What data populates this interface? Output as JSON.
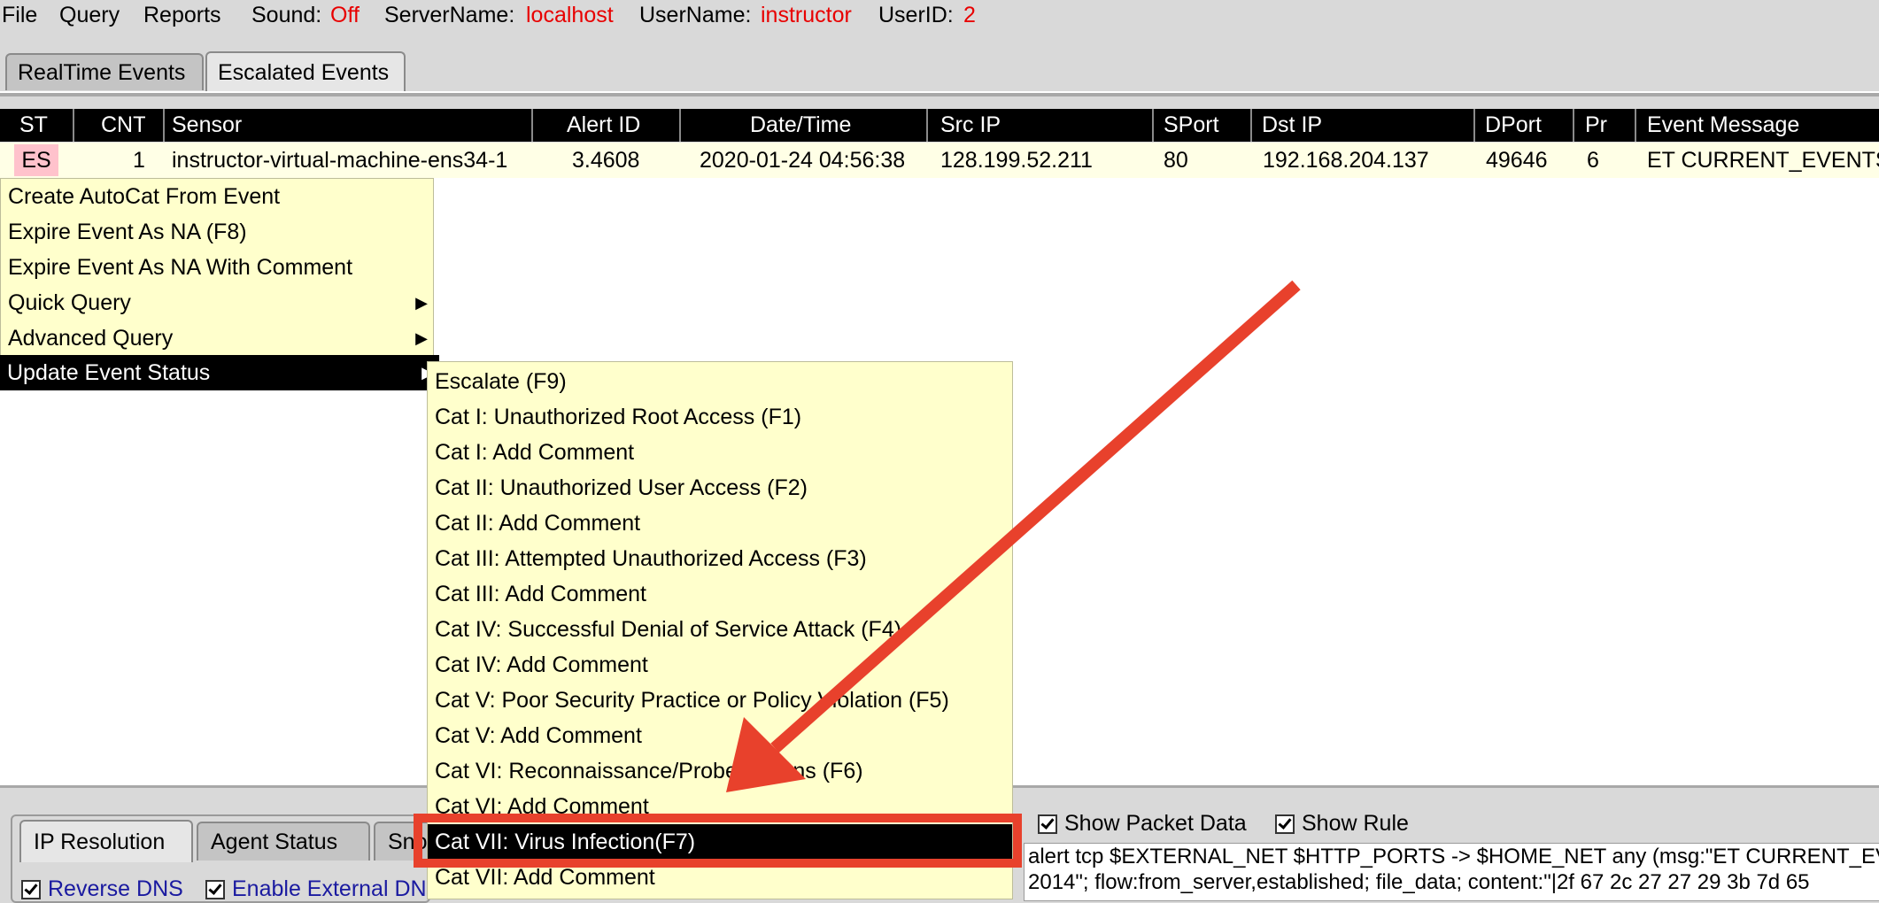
{
  "menubar": {
    "file": "File",
    "query": "Query",
    "reports": "Reports",
    "sound_label": "Sound:",
    "sound_value": "Off",
    "servername_label": "ServerName:",
    "servername_value": "localhost",
    "username_label": "UserName:",
    "username_value": "instructor",
    "userid_label": "UserID:",
    "userid_value": "2"
  },
  "tabs": [
    {
      "label": "RealTime Events",
      "active": false
    },
    {
      "label": "Escalated Events",
      "active": true
    }
  ],
  "table": {
    "columns": [
      "ST",
      "CNT",
      "Sensor",
      "Alert ID",
      "Date/Time",
      "Src IP",
      "SPort",
      "Dst IP",
      "DPort",
      "Pr",
      "Event Message"
    ],
    "rows": [
      {
        "st": "ES",
        "cnt": "1",
        "sensor": "instructor-virtual-machine-ens34-1",
        "alert_id": "3.4608",
        "datetime": "2020-01-24 04:56:38",
        "src_ip": "128.199.52.211",
        "sport": "80",
        "dst_ip": "192.168.204.137",
        "dport": "49646",
        "pr": "6",
        "message": "ET CURRENT_EVENTS"
      }
    ],
    "st_color": "#ffc2cc",
    "row_color": "#ffffe6"
  },
  "context_menu": {
    "items": [
      {
        "label": "Create AutoCat From Event"
      },
      {
        "label": "Expire Event As NA (F8)"
      },
      {
        "label": "Expire Event As NA With Comment"
      },
      {
        "label": "Quick Query",
        "submenu": true
      },
      {
        "label": "Advanced Query",
        "submenu": true
      },
      {
        "label": "Update Event Status",
        "submenu": true,
        "selected": true
      }
    ]
  },
  "submenu": {
    "items": [
      {
        "label": "Escalate (F9)"
      },
      {
        "label": "Cat I: Unauthorized Root Access (F1)"
      },
      {
        "label": "Cat I: Add Comment"
      },
      {
        "label": "Cat II: Unauthorized User Access (F2)"
      },
      {
        "label": "Cat II: Add Comment"
      },
      {
        "label": "Cat III: Attempted Unauthorized Access (F3)"
      },
      {
        "label": "Cat III: Add Comment"
      },
      {
        "label": "Cat IV: Successful Denial of Service Attack (F4)"
      },
      {
        "label": "Cat IV: Add Comment"
      },
      {
        "label": "Cat V: Poor Security Practice or Policy Violation (F5)"
      },
      {
        "label": "Cat V: Add Comment"
      },
      {
        "label": "Cat VI: Reconnaissance/Probes/Scans (F6)"
      },
      {
        "label": "Cat VI: Add Comment"
      },
      {
        "label": "Cat VII: Virus Infection(F7)",
        "selected": true
      },
      {
        "label": "Cat VII: Add Comment"
      }
    ]
  },
  "bottom": {
    "tabs": [
      "IP Resolution",
      "Agent Status",
      "Sno"
    ],
    "reverse_dns": "Reverse DNS",
    "external_dns": "Enable External DNS",
    "show_packet": "Show Packet Data",
    "show_rule": "Show Rule",
    "rule_line1": "alert tcp $EXTERNAL_NET $HTTP_PORTS -> $HOME_NET any (msg:\"ET CURRENT_EVENTS",
    "rule_line2": "2014\"; flow:from_server,established; file_data; content:\"|2f 67 2c 27 27 29 3b 7d 65"
  },
  "annotation": {
    "color": "#e8412c",
    "highlight_target": "Cat VII: Virus Infection(F7)"
  }
}
